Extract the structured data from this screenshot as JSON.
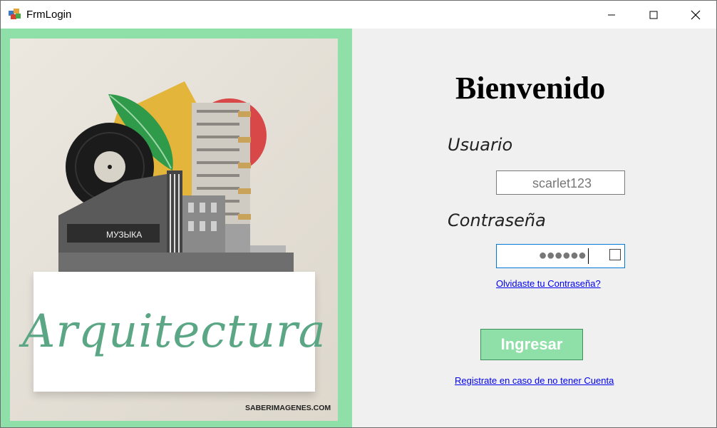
{
  "window": {
    "title": "FrmLogin",
    "controls": [
      "minimize-icon",
      "maximize-icon",
      "close-icon"
    ]
  },
  "poster": {
    "caption": "Arquitectura",
    "watermark": "SABERIMAGENES.COM",
    "sign_text": "МУЗЫКА",
    "frame_color": "#8ee0a8",
    "caption_color": "#5aa685"
  },
  "login": {
    "heading": "Bienvenido",
    "username_label": "Usuario",
    "username_value": "scarlet123",
    "password_label": "Contraseña",
    "password_mask": "●●●●●●",
    "forgot_link": "Olvidaste tu Contraseña?",
    "submit_label": "Ingresar",
    "register_link": "Registrate en caso de no tener Cuenta",
    "accent_color": "#8ee0a8"
  }
}
